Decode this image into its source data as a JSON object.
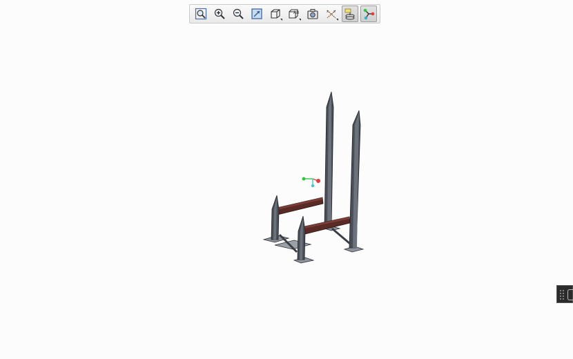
{
  "toolbar": {
    "buttons": [
      {
        "icon": "zoom-fit-icon",
        "active": false,
        "dropdown": false
      },
      {
        "icon": "zoom-in-icon",
        "active": false,
        "dropdown": false
      },
      {
        "icon": "zoom-out-icon",
        "active": false,
        "dropdown": false
      },
      {
        "icon": "refit-window-icon",
        "active": false,
        "dropdown": false
      },
      {
        "icon": "saved-views-icon",
        "active": false,
        "dropdown": true
      },
      {
        "icon": "display-style-icon",
        "active": false,
        "dropdown": true
      },
      {
        "icon": "view-manager-icon",
        "active": false,
        "dropdown": false
      },
      {
        "icon": "datum-display-icon",
        "active": false,
        "dropdown": true
      },
      {
        "icon": "annotation-display-icon",
        "active": true,
        "dropdown": false
      },
      {
        "icon": "spin-center-icon",
        "active": true,
        "dropdown": false
      }
    ]
  },
  "model": {
    "frame_color": "#4a4f57",
    "beam_color": "#5a2a26",
    "spin_center_colors": [
      "#2fc742",
      "#e23b3b",
      "#3fc9c9"
    ]
  },
  "side_panel": {
    "color": "#2b2b2b"
  }
}
